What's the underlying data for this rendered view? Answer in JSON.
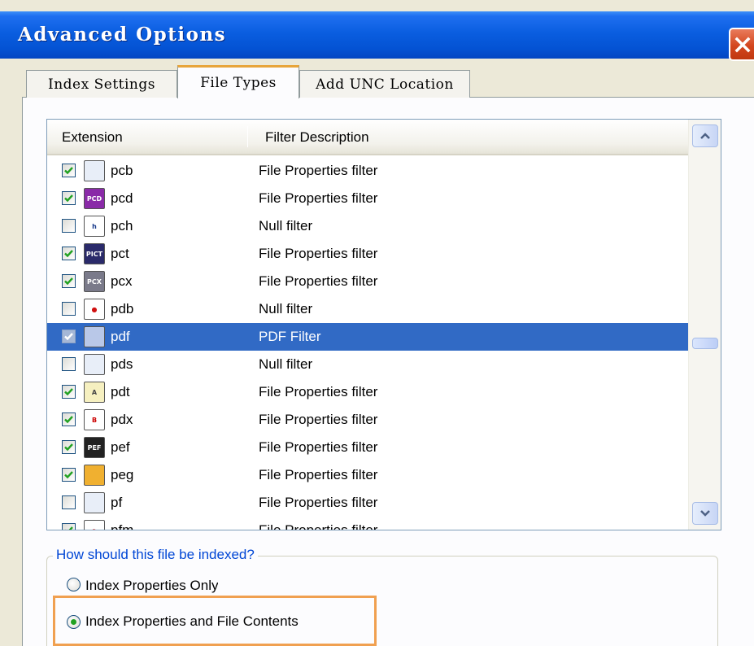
{
  "window": {
    "title": "Advanced Options"
  },
  "tabs": [
    {
      "label": "Index Settings",
      "active": false
    },
    {
      "label": "File Types",
      "active": true
    },
    {
      "label": "Add UNC Location",
      "active": false
    }
  ],
  "list": {
    "columns": [
      "Extension",
      "Filter Description"
    ],
    "rows": [
      {
        "checked": true,
        "icon": "generic-file-icon",
        "ext": "pcb",
        "desc": "File Properties filter"
      },
      {
        "checked": true,
        "icon": "pcd-image-icon",
        "ext": "pcd",
        "desc": "File Properties filter"
      },
      {
        "checked": false,
        "icon": "header-file-icon",
        "ext": "pch",
        "desc": "Null filter"
      },
      {
        "checked": true,
        "icon": "pict-image-icon",
        "ext": "pct",
        "desc": "File Properties filter"
      },
      {
        "checked": true,
        "icon": "pcx-image-icon",
        "ext": "pcx",
        "desc": "File Properties filter"
      },
      {
        "checked": false,
        "icon": "database-file-icon",
        "ext": "pdb",
        "desc": "Null filter"
      },
      {
        "checked": true,
        "icon": "pdf-file-icon",
        "ext": "pdf",
        "desc": "PDF Filter",
        "selected": true
      },
      {
        "checked": false,
        "icon": "generic-file-icon",
        "ext": "pds",
        "desc": "Null filter"
      },
      {
        "checked": true,
        "icon": "pdt-file-icon",
        "ext": "pdt",
        "desc": "File Properties filter"
      },
      {
        "checked": true,
        "icon": "pdx-file-icon",
        "ext": "pdx",
        "desc": "File Properties filter"
      },
      {
        "checked": true,
        "icon": "pef-image-icon",
        "ext": "pef",
        "desc": "File Properties filter"
      },
      {
        "checked": true,
        "icon": "peg-file-icon",
        "ext": "peg",
        "desc": "File Properties filter"
      },
      {
        "checked": false,
        "icon": "generic-file-icon",
        "ext": "pf",
        "desc": "File Properties filter"
      },
      {
        "checked": true,
        "icon": "pfm-font-icon",
        "ext": "pfm",
        "desc": "File Properties filter"
      }
    ]
  },
  "indexing": {
    "legend": "How should this file be indexed?",
    "option_1": "Index Properties Only",
    "option_2": "Index Properties and File Contents",
    "selected_option": 2
  },
  "colors": {
    "title_bar": "#0a5ee0",
    "selection": "#316ac5",
    "highlight_box": "#f0a050",
    "legend_text": "#0046d5"
  }
}
